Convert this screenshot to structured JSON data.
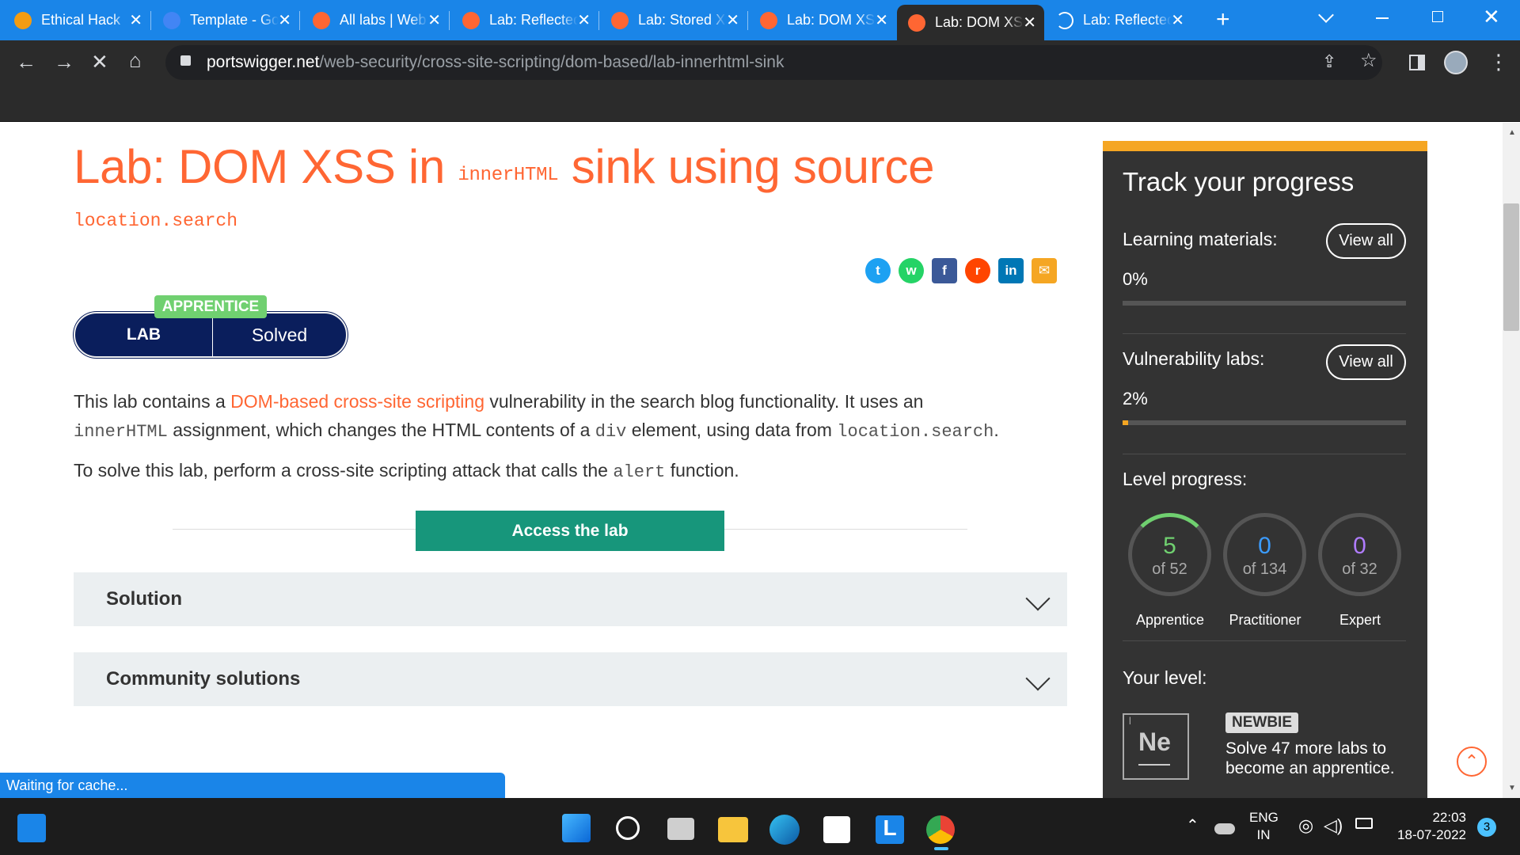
{
  "browser": {
    "tabs": [
      {
        "title": "Ethical Hack",
        "icon": "hacker-favicon",
        "color": "#f39c12"
      },
      {
        "title": "Template - Google Docs",
        "icon": "docs-favicon",
        "color": "#4285f4"
      },
      {
        "title": "All labs | Web Security Academy",
        "icon": "portswigger-favicon",
        "color": "#ff6633"
      },
      {
        "title": "Lab: Reflected XSS",
        "icon": "portswigger-favicon",
        "color": "#ff6633"
      },
      {
        "title": "Lab: Stored XSS",
        "icon": "portswigger-favicon",
        "color": "#ff6633"
      },
      {
        "title": "Lab: DOM XSS",
        "icon": "portswigger-favicon",
        "color": "#ff6633"
      },
      {
        "title": "Lab: DOM XSS",
        "icon": "portswigger-favicon",
        "color": "#ff6633",
        "active": true
      },
      {
        "title": "Lab: Reflected XSS",
        "icon": "loading-spinner",
        "color": "#fff"
      }
    ],
    "url_domain": "portswigger.net",
    "url_path": "/web-security/cross-site-scripting/dom-based/lab-innerhtml-sink",
    "status_text": "Waiting for cache..."
  },
  "lab": {
    "title_pre": "Lab: DOM XSS in",
    "title_code": "innerHTML",
    "title_post": "sink using source",
    "title_code2": "location.search",
    "level_badge": "APPRENTICE",
    "pill_left": "LAB",
    "pill_right": "Solved",
    "p1_a": "This lab contains a ",
    "p1_link": "DOM-based cross-site scripting",
    "p1_b": " vulnerability in the search blog functionality. It uses an",
    "p2_code1": "innerHTML",
    "p2_a": " assignment, which changes the HTML contents of a ",
    "p2_code2": "div",
    "p2_b": " element, using data from ",
    "p2_code3": "location.search",
    "p2_c": ".",
    "p3_a": "To solve this lab, perform a cross-site scripting attack that calls the ",
    "p3_code": "alert",
    "p3_b": " function.",
    "access_button": "Access the lab",
    "accordions": [
      "Solution",
      "Community solutions"
    ]
  },
  "share_icons": [
    {
      "name": "twitter-icon",
      "glyph": "t",
      "color": "#1da1f2"
    },
    {
      "name": "whatsapp-icon",
      "glyph": "w",
      "color": "#25d366"
    },
    {
      "name": "facebook-icon",
      "glyph": "f",
      "color": "#3b5998"
    },
    {
      "name": "reddit-icon",
      "glyph": "r",
      "color": "#ff4500"
    },
    {
      "name": "linkedin-icon",
      "glyph": "in",
      "color": "#0077b5"
    },
    {
      "name": "email-icon",
      "glyph": "✉",
      "color": "#f5a623"
    }
  ],
  "progress": {
    "title": "Track your progress",
    "learning_label": "Learning materials:",
    "learning_value": "0%",
    "learning_fraction": 0.0,
    "vuln_label": "Vulnerability labs:",
    "vuln_value": "2%",
    "vuln_fraction": 0.02,
    "view_all": "View all",
    "level_label": "Level progress:",
    "levels": [
      {
        "count": "5",
        "of": "of 52",
        "name": "Apprentice",
        "color": "#70d070",
        "fraction": 0.096
      },
      {
        "count": "0",
        "of": "of 134",
        "name": "Practitioner",
        "color": "#3b9cff",
        "fraction": 0
      },
      {
        "count": "0",
        "of": "of 32",
        "name": "Expert",
        "color": "#b07cff",
        "fraction": 0
      }
    ],
    "your_level_label": "Your level:",
    "element_symbol": "Ne",
    "badge": "NEWBIE",
    "level_msg_1": "Solve 47 more labs to",
    "level_msg_2": "become an apprentice."
  },
  "taskbar": {
    "lang_1": "ENG",
    "lang_2": "IN",
    "time": "22:03",
    "date": "18-07-2022",
    "notifications": "3"
  }
}
